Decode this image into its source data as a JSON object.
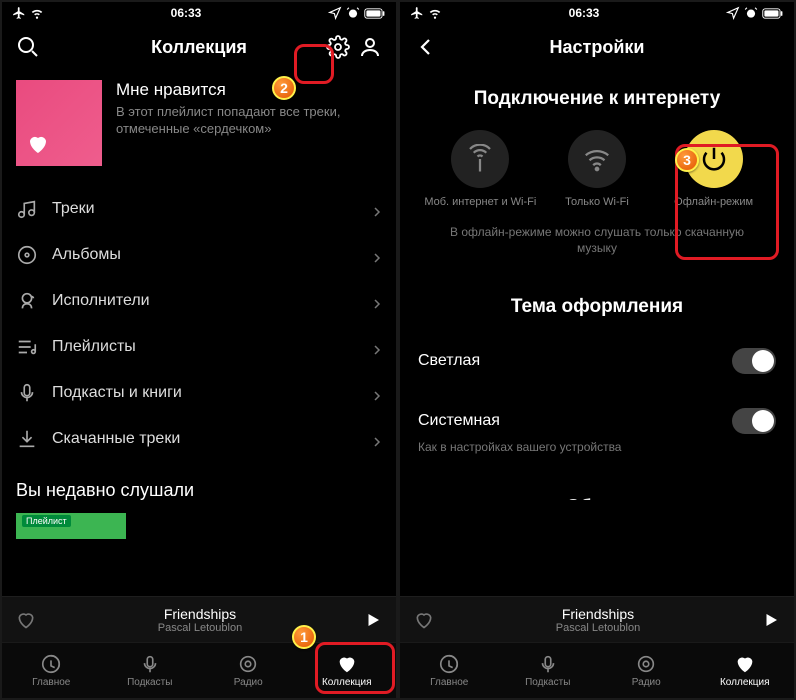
{
  "status": {
    "time": "06:33"
  },
  "left": {
    "header_title": "Коллекция",
    "liked": {
      "title": "Мне нравится",
      "desc": "В этот плейлист попадают все треки, отмеченные «сердечком»"
    },
    "menu": [
      {
        "label": "Треки"
      },
      {
        "label": "Альбомы"
      },
      {
        "label": "Исполнители"
      },
      {
        "label": "Плейлисты"
      },
      {
        "label": "Подкасты и книги"
      },
      {
        "label": "Скачанные треки"
      }
    ],
    "recent_title": "Вы недавно слушали",
    "recent_tag": "Плейлист"
  },
  "right": {
    "header_title": "Настройки",
    "net_title": "Подключение к интернету",
    "net_modes": [
      {
        "label": "Моб. интернет и Wi-Fi"
      },
      {
        "label": "Только Wi-Fi"
      },
      {
        "label": "Офлайн-режим"
      }
    ],
    "net_hint": "В офлайн-режиме можно слушать только скачанную музыку",
    "theme_title": "Тема оформления",
    "theme_light": "Светлая",
    "theme_system": "Системная",
    "theme_system_sub": "Как в настройках вашего устройства",
    "partial_section": "Общие"
  },
  "now_playing": {
    "title": "Friendships",
    "artist": "Pascal Letoublon"
  },
  "tabs": [
    {
      "label": "Главное"
    },
    {
      "label": "Подкасты"
    },
    {
      "label": "Радио"
    },
    {
      "label": "Коллекция"
    }
  ],
  "callouts": {
    "one": "1",
    "two": "2",
    "three": "3"
  }
}
